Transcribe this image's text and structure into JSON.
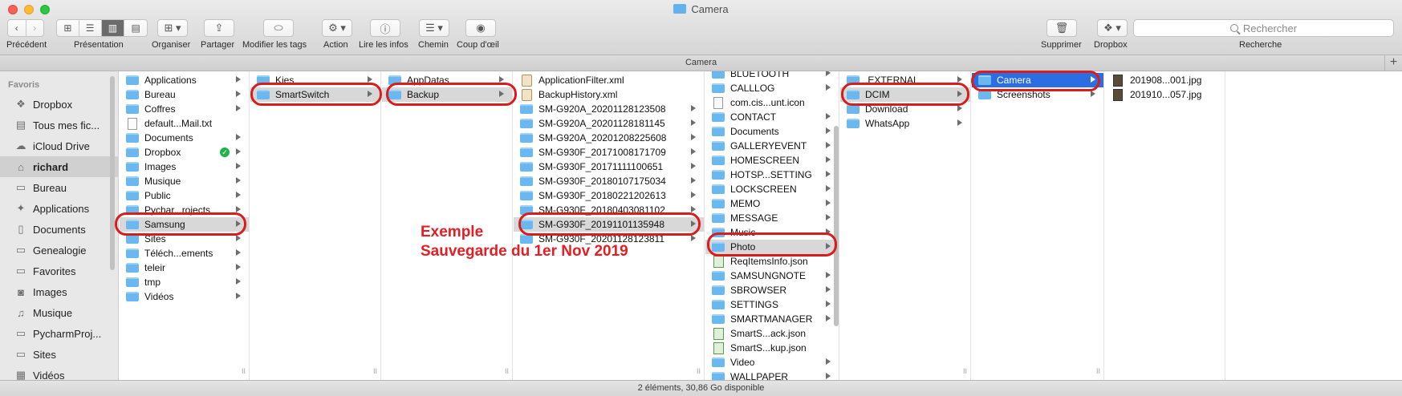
{
  "window": {
    "title": "Camera"
  },
  "toolbar": {
    "back_label": "Précédent",
    "view_label": "Présentation",
    "arrange_label": "Organiser",
    "share_label": "Partager",
    "tags_label": "Modifier les tags",
    "action_label": "Action",
    "info_label": "Lire les infos",
    "path_label": "Chemin",
    "quicklook_label": "Coup d'œil",
    "delete_label": "Supprimer",
    "dropbox_label": "Dropbox",
    "search_placeholder": "Rechercher",
    "search_label": "Recherche"
  },
  "tabbar": {
    "title": "Camera"
  },
  "sidebar": {
    "header": "Favoris",
    "items": [
      {
        "label": "Dropbox",
        "icon": "dropbox-icon"
      },
      {
        "label": "Tous mes fic...",
        "icon": "all-files-icon"
      },
      {
        "label": "iCloud Drive",
        "icon": "cloud-icon"
      },
      {
        "label": "richard",
        "icon": "home-icon"
      },
      {
        "label": "Bureau",
        "icon": "desktop-icon"
      },
      {
        "label": "Applications",
        "icon": "applications-icon"
      },
      {
        "label": "Documents",
        "icon": "documents-icon"
      },
      {
        "label": "Genealogie",
        "icon": "folder-icon"
      },
      {
        "label": "Favorites",
        "icon": "folder-icon"
      },
      {
        "label": "Images",
        "icon": "camera-icon"
      },
      {
        "label": "Musique",
        "icon": "music-icon"
      },
      {
        "label": "PycharmProj...",
        "icon": "folder-icon"
      },
      {
        "label": "Sites",
        "icon": "folder-icon"
      },
      {
        "label": "Vidéos",
        "icon": "film-icon"
      }
    ]
  },
  "columns": {
    "c1": [
      "Applications",
      "Bureau",
      "Coffres",
      "default...Mail.txt",
      "Documents",
      "Dropbox",
      "Images",
      "Musique",
      "Public",
      "Pychar...rojects",
      "Samsung",
      "Sites",
      "Téléch...ements",
      "teleir",
      "tmp",
      "Vidéos"
    ],
    "c2": [
      "Kies",
      "SmartSwitch"
    ],
    "c3": [
      "AppDatas",
      "Backup"
    ],
    "c4": [
      "ApplicationFilter.xml",
      "BackupHistory.xml",
      "SM-G920A_20201128123508",
      "SM-G920A_20201128181145",
      "SM-G920A_20201208225608",
      "SM-G930F_20171008171709",
      "SM-G930F_20171111100651",
      "SM-G930F_20180107175034",
      "SM-G930F_20180221202613",
      "SM-G930F_20180403081102",
      "SM-G930F_20191101135948",
      "SM-G930F_20201128123811"
    ],
    "c5": [
      "BLUETOOTH",
      "CALLLOG",
      "com.cis...unt.icon",
      "CONTACT",
      "Documents",
      "GALLERYEVENT",
      "HOMESCREEN",
      "HOTSP...SETTING",
      "LOCKSCREEN",
      "MEMO",
      "MESSAGE",
      "Music",
      "Photo",
      "ReqItemsInfo.json",
      "SAMSUNGNOTE",
      "SBROWSER",
      "SETTINGS",
      "SMARTMANAGER",
      "SmartS...ack.json",
      "SmartS...kup.json",
      "Video",
      "WALLPAPER"
    ],
    "c6": [
      ".EXTERNAL",
      "DCIM",
      "Download",
      "WhatsApp"
    ],
    "c7": [
      "Camera",
      "Screenshots"
    ],
    "c8": [
      "201908...001.jpg",
      "201910...057.jpg"
    ]
  },
  "annotation": {
    "line1": "Exemple",
    "line2": "Sauvegarde du 1er Nov 2019"
  },
  "status": {
    "text": "2 éléments, 30,86 Go disponible"
  },
  "colors": {
    "accent_selection": "#2b6ee3",
    "annotation_red": "#e51e24",
    "folder_blue": "#6bb7f0"
  }
}
